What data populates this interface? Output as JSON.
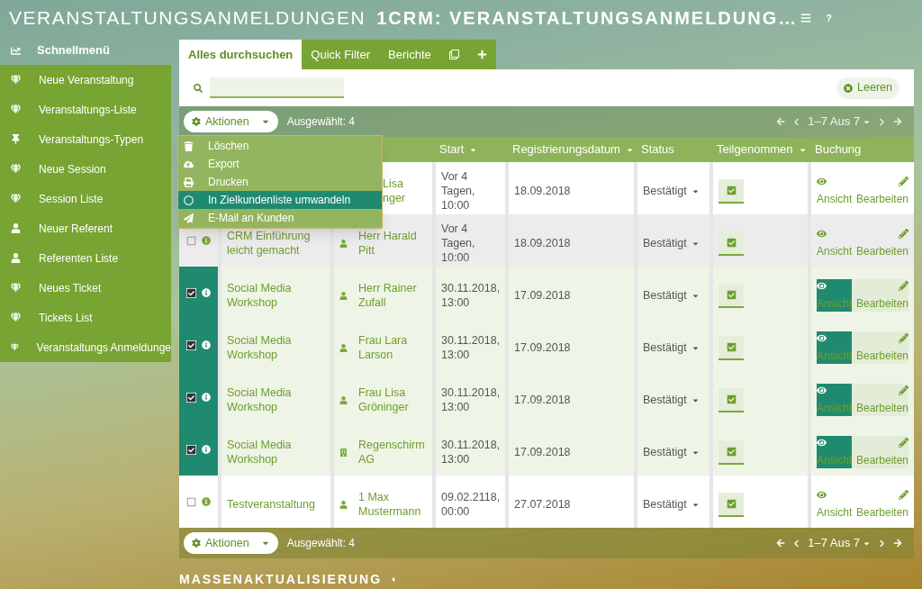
{
  "title": {
    "main": "VERANSTALTUNGSANMELDUNGEN",
    "sub": "1CRM: VERANSTALTUNGSANMELDUNG…",
    "help": "?"
  },
  "sidebar": {
    "title": "Schnellmenü",
    "items": [
      {
        "label": "Neue Veranstaltung",
        "kind": "gem"
      },
      {
        "label": "Veranstaltungs-Liste",
        "kind": "gem"
      },
      {
        "label": "Veranstaltungs-Typen",
        "kind": "pin"
      },
      {
        "label": "Neue Session",
        "kind": "gem"
      },
      {
        "label": "Session Liste",
        "kind": "gem"
      },
      {
        "label": "Neuer Referent",
        "kind": "person"
      },
      {
        "label": "Referenten Liste",
        "kind": "person"
      },
      {
        "label": "Neues Ticket",
        "kind": "gem"
      },
      {
        "label": "Tickets List",
        "kind": "gem"
      },
      {
        "label": "Veranstaltungs Anmeldunge",
        "kind": "gem"
      }
    ]
  },
  "tabs": [
    {
      "label": "Alles durchsuchen",
      "selected": true
    },
    {
      "label": "Quick Filter",
      "selected": false
    },
    {
      "label": "Berichte",
      "selected": false
    }
  ],
  "search": {
    "clear": "Leeren"
  },
  "toolbar_top": {
    "actions": "Aktionen",
    "selected_count": "Ausgewählt: 4",
    "pagination": "1–7 Aus 7"
  },
  "actions_menu": [
    {
      "label": "Löschen",
      "kind": "trash",
      "selected": false
    },
    {
      "label": "Export",
      "kind": "upload",
      "selected": false
    },
    {
      "label": "Drucken",
      "kind": "print",
      "selected": false
    },
    {
      "label": "In Zielkundenliste umwandeln",
      "kind": "circle",
      "selected": true
    },
    {
      "label": "E-Mail an Kunden",
      "kind": "send",
      "selected": false
    }
  ],
  "table": {
    "columns": [
      {
        "label": "Start",
        "sortable": true
      },
      {
        "label": "Registrierungsdatum",
        "sortable": true
      },
      {
        "label": "Status",
        "sortable": false
      },
      {
        "label": "Teilgenommen",
        "sortable": true
      },
      {
        "label": "Buchung",
        "sortable": false
      }
    ],
    "rows": [
      {
        "covered": true,
        "contact_lines": [
          "Lisa",
          "nger"
        ],
        "start": "Vor 4 Tagen, 10:00",
        "registered": "18.09.2018",
        "status": "Bestätigt",
        "attended": true,
        "view": "Ansicht",
        "edit": "Bearbeiten"
      },
      {
        "selected": false,
        "covered": false,
        "kind": "person",
        "event": "CRM Einführung leicht gemacht",
        "contact_lines": [
          "Herr Harald",
          "Pitt"
        ],
        "start": "Vor 4 Tagen, 10:00",
        "registered": "18.09.2018",
        "status": "Bestätigt",
        "attended": true,
        "view": "Ansicht",
        "edit": "Bearbeiten"
      },
      {
        "selected": true,
        "covered": false,
        "kind": "person",
        "event": "Social Media Workshop",
        "contact_lines": [
          "Herr Rainer",
          "Zufall"
        ],
        "start": "30.11.2018, 13:00",
        "registered": "17.09.2018",
        "status": "Bestätigt",
        "attended": true,
        "view": "Ansicht",
        "edit": "Bearbeiten"
      },
      {
        "selected": true,
        "covered": false,
        "kind": "person",
        "event": "Social Media Workshop",
        "contact_lines": [
          "Frau Lara",
          "Larson"
        ],
        "start": "30.11.2018, 13:00",
        "registered": "17.09.2018",
        "status": "Bestätigt",
        "attended": true,
        "view": "Ansicht",
        "edit": "Bearbeiten"
      },
      {
        "selected": true,
        "covered": false,
        "kind": "person",
        "event": "Social Media Workshop",
        "contact_lines": [
          "Frau Lisa",
          "Gröninger"
        ],
        "start": "30.11.2018, 13:00",
        "registered": "17.09.2018",
        "status": "Bestätigt",
        "attended": true,
        "view": "Ansicht",
        "edit": "Bearbeiten"
      },
      {
        "selected": true,
        "covered": false,
        "kind": "company",
        "event": "Social Media Workshop",
        "contact_lines": [
          "Regenschirm",
          "AG"
        ],
        "start": "30.11.2018, 13:00",
        "registered": "17.09.2018",
        "status": "Bestätigt",
        "attended": true,
        "view": "Ansicht",
        "edit": "Bearbeiten"
      },
      {
        "selected": false,
        "covered": false,
        "kind": "person",
        "event": "Testveranstaltung",
        "contact_lines": [
          "1 Max",
          "Mustermann"
        ],
        "start": "09.02.2118, 00:00",
        "registered": "27.07.2018",
        "status": "Bestätigt",
        "attended": true,
        "view": "Ansicht",
        "edit": "Bearbeiten"
      }
    ]
  },
  "toolbar_bottom": {
    "actions": "Aktionen",
    "selected_count": "Ausgewählt: 4",
    "pagination": "1–7 Aus 7"
  },
  "mass_update": {
    "label": "MASSENAKTUALISIERUNG",
    "expanded": false
  }
}
